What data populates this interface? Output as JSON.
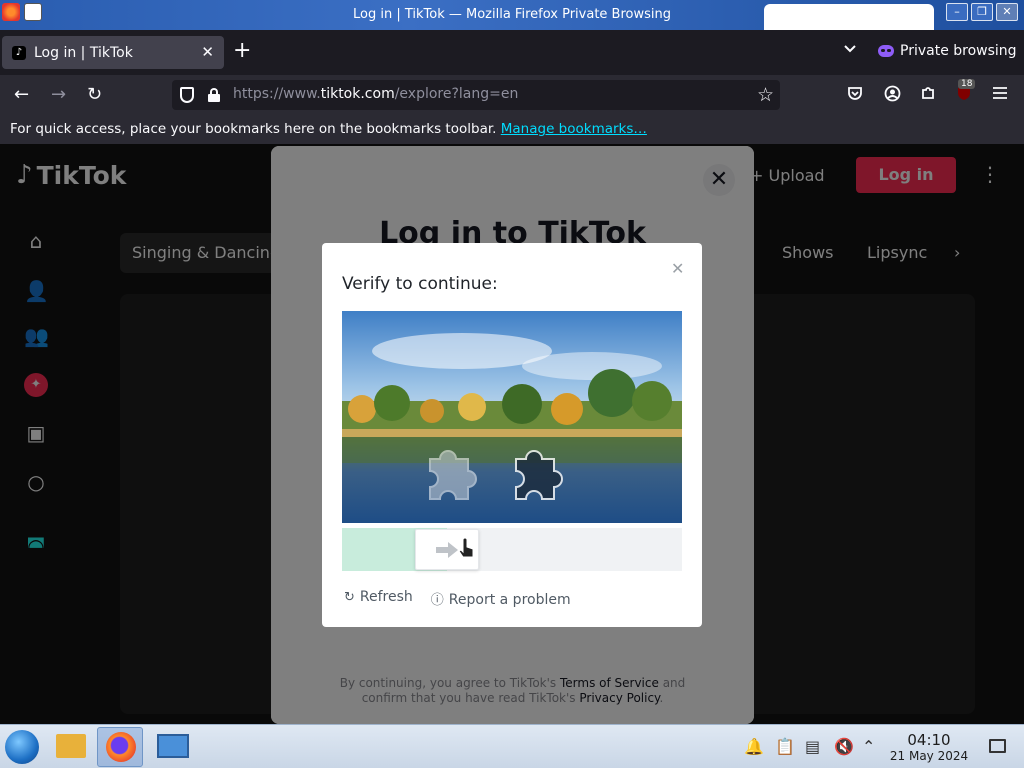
{
  "window": {
    "title": "Log in | TikTok — Mozilla Firefox Private Browsing",
    "buttons": {
      "minimize": "–",
      "maximize": "❐",
      "close": "✕"
    }
  },
  "tabs": [
    {
      "label": "Log in | TikTok",
      "close": "✕"
    }
  ],
  "tabstrip": {
    "new_tab": "+",
    "list_all": "⌄",
    "private_label": "Private browsing"
  },
  "navbar": {
    "back": "←",
    "forward": "→",
    "reload": "↻",
    "url_prefix": "https://www.",
    "url_host": "tiktok.com",
    "url_suffix": "/explore?lang=en",
    "bookmark_star": "☆",
    "extensions_badge": "18"
  },
  "bookmarks_bar": {
    "text": "For quick access, place your bookmarks here on the bookmarks toolbar.",
    "link": "Manage bookmarks…"
  },
  "tiktok": {
    "logo_text": "TikTok",
    "upload_label": "Upload",
    "login_button": "Log in",
    "chips": [
      "Singing & Dancing",
      "Shows",
      "Lipsync"
    ],
    "chevron": "›"
  },
  "login_modal": {
    "title": "Log in to TikTok",
    "terms_line1_pre": "By continuing, you agree to TikTok's ",
    "terms_link": "Terms of Service",
    "terms_line1_post": " and",
    "terms_line2_pre": "confirm that you have read TikTok's ",
    "privacy_link": "Privacy Policy",
    "terms_line2_post": "."
  },
  "captcha": {
    "title": "Verify to continue:",
    "refresh_label": "Refresh",
    "report_label": "Report a problem",
    "slider_progress": 0.31
  },
  "taskbar": {
    "time": "04:10",
    "date": "21 May 2024"
  },
  "colors": {
    "tiktok_red": "#fe2c55",
    "link_cyan": "#00ddff",
    "private_purple": "#8e5cf7",
    "slider_fill": "#c8ecdc"
  }
}
